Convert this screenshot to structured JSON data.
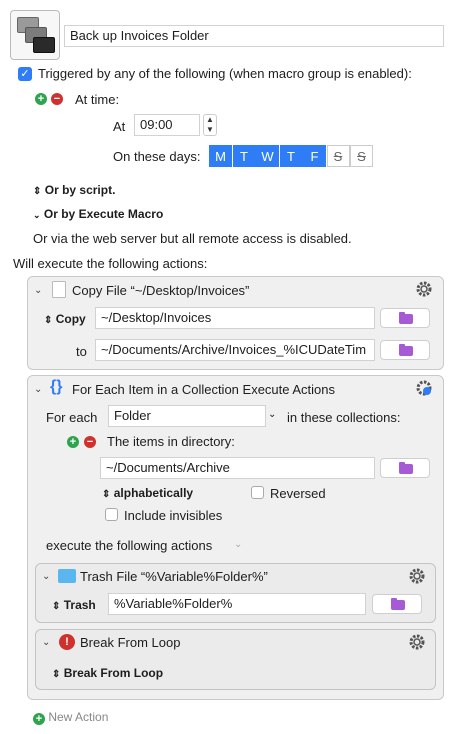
{
  "macro": {
    "name": "Back up Invoices Folder"
  },
  "trigger": {
    "triggered_label": "Triggered by any of the following (when macro group is enabled):",
    "at_time_label": "At time:",
    "at_label": "At",
    "time_value": "09:00",
    "days_label": "On these days:",
    "days": [
      {
        "letter": "M",
        "on": true
      },
      {
        "letter": "T",
        "on": true
      },
      {
        "letter": "W",
        "on": true
      },
      {
        "letter": "T",
        "on": true
      },
      {
        "letter": "F",
        "on": true
      },
      {
        "letter": "S",
        "on": false
      },
      {
        "letter": "S",
        "on": false
      }
    ],
    "or_by_script": "Or by script.",
    "or_by_execute_macro": "Or by Execute Macro",
    "web_server_note": "Or via the web server but all remote access is disabled."
  },
  "actions_header": "Will execute the following actions:",
  "copy_action": {
    "title": "Copy File “~/Desktop/Invoices”",
    "copy_label": "Copy",
    "copy_value": "~/Desktop/Invoices",
    "to_label": "to",
    "to_value": "~/Documents/Archive/Invoices_%ICUDateTim"
  },
  "foreach_action": {
    "title": "For Each Item in a Collection Execute Actions",
    "for_each_label": "For each",
    "variable_value": "Folder",
    "collections_label": "in these collections:",
    "items_label": "The items in directory:",
    "directory_value": "~/Documents/Archive",
    "sort_label": "alphabetically",
    "reversed_label": "Reversed",
    "invisibles_label": "Include invisibles",
    "execute_label": "execute the following actions"
  },
  "trash_action": {
    "title": "Trash File “%Variable%Folder%”",
    "trash_label": "Trash",
    "trash_value": "%Variable%Folder%"
  },
  "break_action": {
    "title": "Break From Loop",
    "option_label": "Break From Loop"
  },
  "new_action_label": "New Action",
  "colors": {
    "accent": "#2f7df6",
    "folder": "#a75ad6",
    "add": "#2ea44f",
    "remove": "#d0312d"
  }
}
